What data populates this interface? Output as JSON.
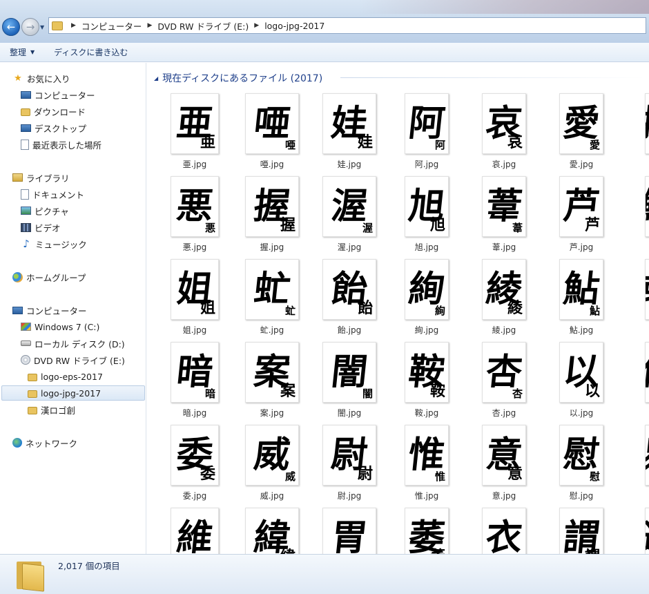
{
  "address": {
    "crumbs": [
      "コンピューター",
      "DVD RW ドライブ (E:)",
      "logo-jpg-2017"
    ]
  },
  "toolbar": {
    "organize_label": "整理",
    "burn_label": "ディスクに書き込む"
  },
  "sidebar": {
    "favorites": {
      "label": "お気に入り",
      "items": [
        "コンピューター",
        "ダウンロード",
        "デスクトップ",
        "最近表示した場所"
      ]
    },
    "libraries": {
      "label": "ライブラリ",
      "items": [
        "ドキュメント",
        "ピクチャ",
        "ビデオ",
        "ミュージック"
      ]
    },
    "homegroup": {
      "label": "ホームグループ"
    },
    "computer": {
      "label": "コンピューター",
      "drives": [
        "Windows 7 (C:)",
        "ローカル ディスク (D:)",
        "DVD RW ドライブ (E:)"
      ],
      "folders": [
        "logo-eps-2017",
        "logo-jpg-2017",
        "漢ロゴ創"
      ]
    },
    "network": {
      "label": "ネットワーク"
    }
  },
  "content": {
    "group_header": "現在ディスクにあるファイル (2017)",
    "files": [
      {
        "name": "亜.jpg",
        "char": "亜"
      },
      {
        "name": "唖.jpg",
        "char": "唖"
      },
      {
        "name": "娃.jpg",
        "char": "娃"
      },
      {
        "name": "阿.jpg",
        "char": "阿"
      },
      {
        "name": "哀.jpg",
        "char": "哀"
      },
      {
        "name": "愛.jpg",
        "char": "愛"
      },
      {
        "name": "挨",
        "char": "挨"
      },
      {
        "name": "悪.jpg",
        "char": "悪"
      },
      {
        "name": "握.jpg",
        "char": "握"
      },
      {
        "name": "渥.jpg",
        "char": "渥"
      },
      {
        "name": "旭.jpg",
        "char": "旭"
      },
      {
        "name": "葦.jpg",
        "char": "葦"
      },
      {
        "name": "芦.jpg",
        "char": "芦"
      },
      {
        "name": "鯵",
        "char": "鯵"
      },
      {
        "name": "姐.jpg",
        "char": "姐"
      },
      {
        "name": "虻.jpg",
        "char": "虻"
      },
      {
        "name": "飴.jpg",
        "char": "飴"
      },
      {
        "name": "絢.jpg",
        "char": "絢"
      },
      {
        "name": "綾.jpg",
        "char": "綾"
      },
      {
        "name": "鮎.jpg",
        "char": "鮎"
      },
      {
        "name": "或",
        "char": "或"
      },
      {
        "name": "暗.jpg",
        "char": "暗"
      },
      {
        "name": "案.jpg",
        "char": "案"
      },
      {
        "name": "闇.jpg",
        "char": "闇"
      },
      {
        "name": "鞍.jpg",
        "char": "鞍"
      },
      {
        "name": "杏.jpg",
        "char": "杏"
      },
      {
        "name": "以.jpg",
        "char": "以"
      },
      {
        "name": "伊",
        "char": "伊"
      },
      {
        "name": "委.jpg",
        "char": "委"
      },
      {
        "name": "威.jpg",
        "char": "威"
      },
      {
        "name": "尉.jpg",
        "char": "尉"
      },
      {
        "name": "惟.jpg",
        "char": "惟"
      },
      {
        "name": "意.jpg",
        "char": "意"
      },
      {
        "name": "慰.jpg",
        "char": "慰"
      },
      {
        "name": "易",
        "char": "易"
      },
      {
        "name": "",
        "char": "維"
      },
      {
        "name": "",
        "char": "緯"
      },
      {
        "name": "",
        "char": "胃"
      },
      {
        "name": "",
        "char": "萎"
      },
      {
        "name": "",
        "char": "衣"
      },
      {
        "name": "",
        "char": "謂"
      },
      {
        "name": "",
        "char": "違"
      }
    ]
  },
  "status": {
    "item_count": "2,017 個の項目"
  }
}
